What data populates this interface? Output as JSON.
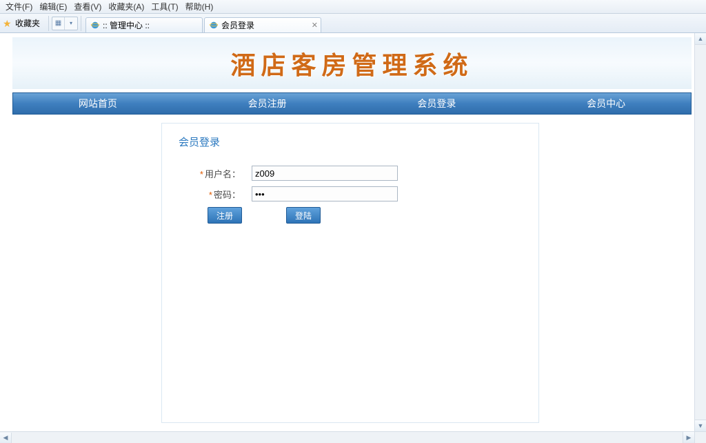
{
  "menubar": {
    "items": [
      "文件(F)",
      "编辑(E)",
      "查看(V)",
      "收藏夹(A)",
      "工具(T)",
      "帮助(H)"
    ]
  },
  "toolbar": {
    "favorites_label": "收藏夹"
  },
  "tabs": [
    {
      "title": ":: 管理中心 ::"
    },
    {
      "title": "会员登录"
    }
  ],
  "banner": {
    "title": "酒店客房管理系统"
  },
  "nav": {
    "items": [
      "网站首页",
      "会员注册",
      "会员登录",
      "会员中心"
    ]
  },
  "login": {
    "heading": "会员登录",
    "username_label": "用户名：",
    "password_label": "密码：",
    "username_value": "z009",
    "password_value": "•••",
    "register_btn": "注册",
    "login_btn": "登陆"
  }
}
